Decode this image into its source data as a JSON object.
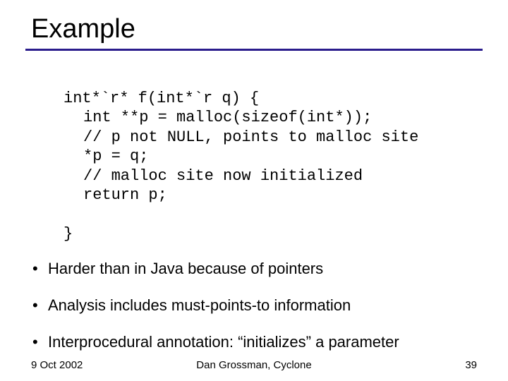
{
  "title": "Example",
  "code": {
    "sig": "int*`r* f(int*`r q) {",
    "l1": "int **p = malloc(sizeof(int*));",
    "l2": "// p not NULL, points to malloc site",
    "l3": "*p = q;",
    "l4": "// malloc site now initialized",
    "l5": "return p;",
    "close": "}"
  },
  "bullets": [
    "Harder than in Java because of pointers",
    "Analysis includes must-points-to information",
    "Interprocedural annotation: “initializes” a parameter"
  ],
  "footer": {
    "date": "9 Oct 2002",
    "author": "Dan Grossman, Cyclone",
    "page": "39"
  }
}
